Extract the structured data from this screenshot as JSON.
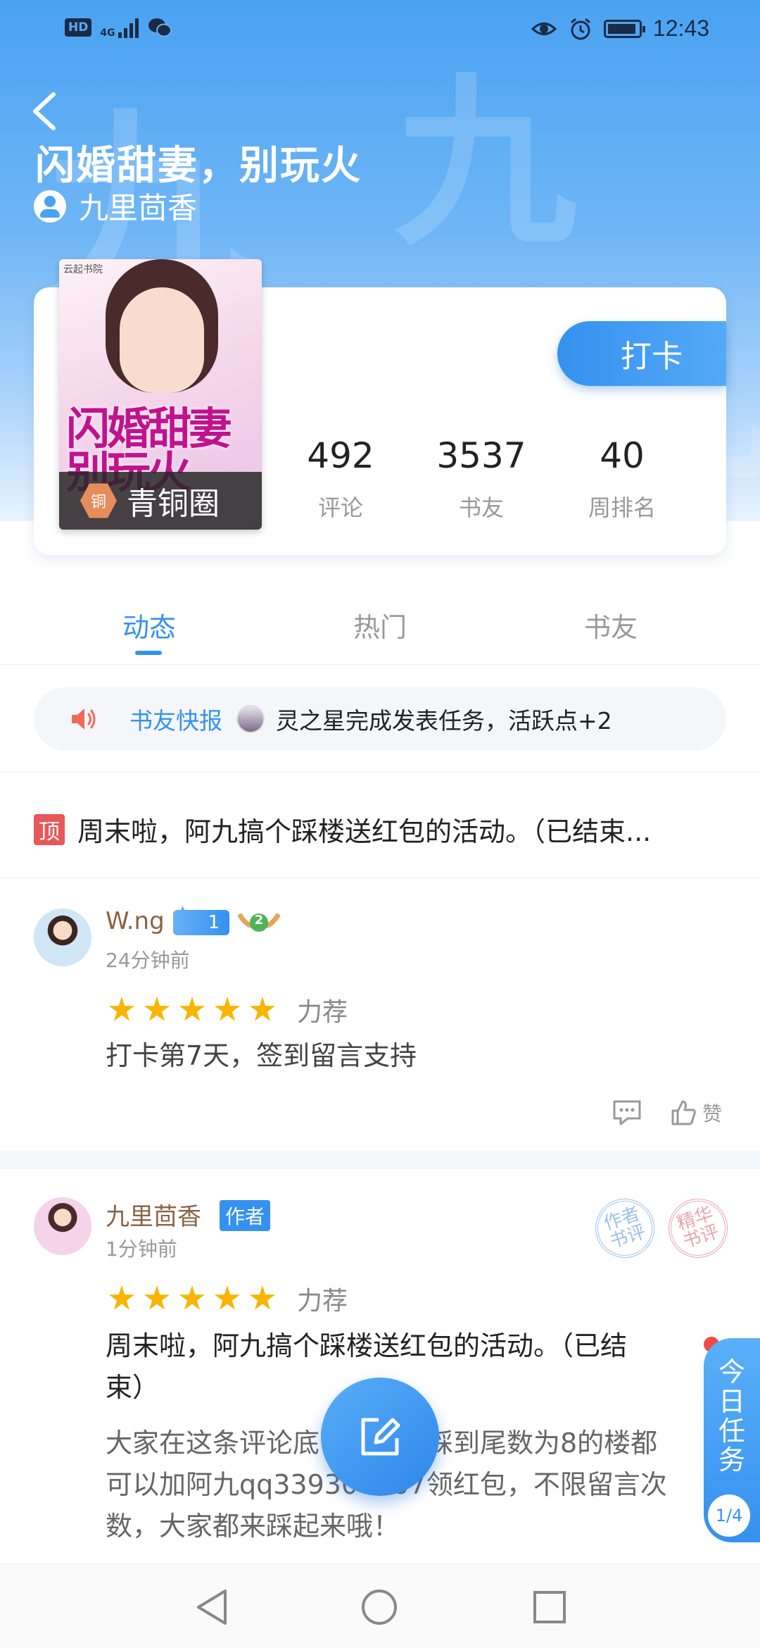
{
  "status_bar": {
    "hd": "HD",
    "network": "4G",
    "time": "12:43"
  },
  "book": {
    "title": "闪婚甜妻，别玩火",
    "author": "九里茴香",
    "cover_publisher": "云起书院",
    "cover_title": "闪婚甜妻别玩火"
  },
  "badge": {
    "icon_text": "铜",
    "label": "青铜圈"
  },
  "checkin_label": "打卡",
  "stats": [
    {
      "value": "492",
      "label": "评论"
    },
    {
      "value": "3537",
      "label": "书友"
    },
    {
      "value": "40",
      "label": "周排名"
    }
  ],
  "tabs": [
    "动态",
    "热门",
    "书友"
  ],
  "ticker": {
    "label": "书友快报",
    "text": "灵之星完成发表任务，活跃点+2"
  },
  "pinned": {
    "tag": "顶",
    "text": "周末啦，阿九搞个踩楼送红包的活动。（已结束..."
  },
  "posts": [
    {
      "username": "W.ng",
      "level": "1",
      "medal_level": "2",
      "time": "24分钟前",
      "rating_label": "力荐",
      "rating": 5,
      "text": "打卡第7天，签到留言支持",
      "like_label": "赞"
    },
    {
      "username": "九里茴香",
      "role_tag": "作者",
      "time": "1分钟前",
      "rating_label": "力荐",
      "rating": 5,
      "stamps": [
        "作者书评",
        "精华书评"
      ],
      "title_line1": "周末啦，阿九搞个踩楼送红包的活动。（已结",
      "title_line2": "束）",
      "body_line1": "大家在这条评论底下留言，踩到尾数为8的楼都",
      "body_line2": "可以加阿九qq339300007领红包，不限留言次",
      "body_line3": "数，大家都来踩起来哦！"
    }
  ],
  "task_widget": {
    "label": "今日任务",
    "progress": "1/4"
  },
  "colors": {
    "accent": "#3591ef",
    "header_gradient_top": "#4aa2f2",
    "username": "#8a6343",
    "star": "#f7b500",
    "pin_tag": "#e8575a"
  }
}
